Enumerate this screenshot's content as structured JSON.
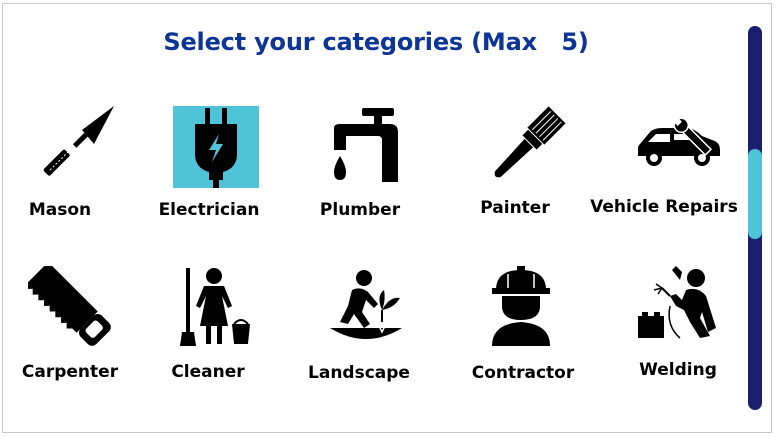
{
  "title": "Select your categories (Max   5)",
  "accent_color": "#4fc3d8",
  "title_color": "#0d3597",
  "scrollbar_color": "#1a1f6e",
  "categories": [
    {
      "label": "Mason",
      "icon": "trowel-icon",
      "selected": false
    },
    {
      "label": "Electrician",
      "icon": "electric-plug-icon",
      "selected": true
    },
    {
      "label": "Plumber",
      "icon": "faucet-icon",
      "selected": false
    },
    {
      "label": "Painter",
      "icon": "paint-brush-icon",
      "selected": false
    },
    {
      "label": "Vehicle Repairs",
      "icon": "car-wrench-icon",
      "selected": false
    },
    {
      "label": "Carpenter",
      "icon": "saw-icon",
      "selected": false
    },
    {
      "label": "Cleaner",
      "icon": "cleaning-lady-icon",
      "selected": false
    },
    {
      "label": "Landscape",
      "icon": "gardener-icon",
      "selected": false
    },
    {
      "label": "Contractor",
      "icon": "hard-hat-worker-icon",
      "selected": false
    },
    {
      "label": "Welding",
      "icon": "welder-icon",
      "selected": false
    }
  ]
}
